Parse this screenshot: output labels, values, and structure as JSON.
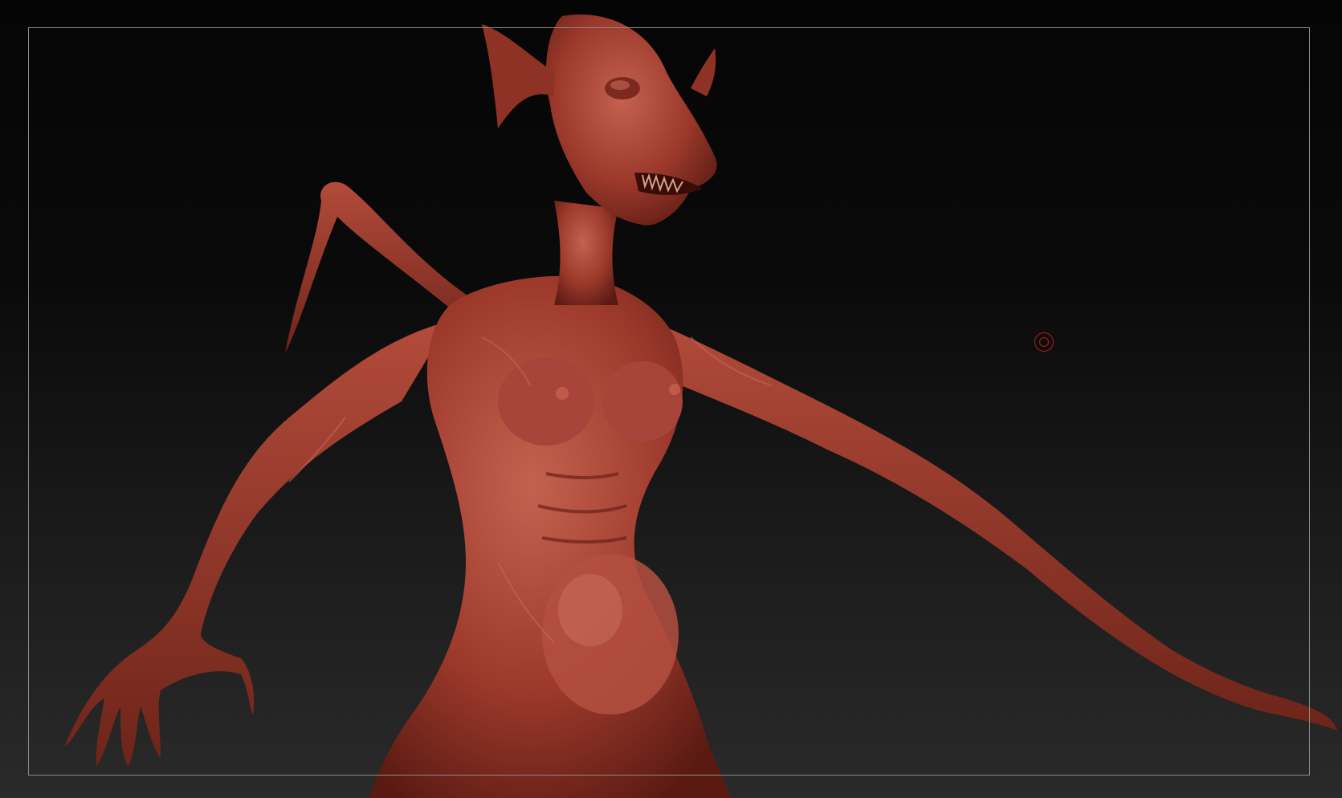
{
  "viewport": {
    "background_top": "#050505",
    "background_bottom": "#2a2a2a",
    "frame_color": "#8a8a8a"
  },
  "model": {
    "material_color": "#9e3a2c",
    "highlight_color": "#c96a58",
    "shadow_color": "#5a1a12"
  },
  "cursor": {
    "icon": "brush-cursor-icon",
    "color": "#b31b1b"
  }
}
